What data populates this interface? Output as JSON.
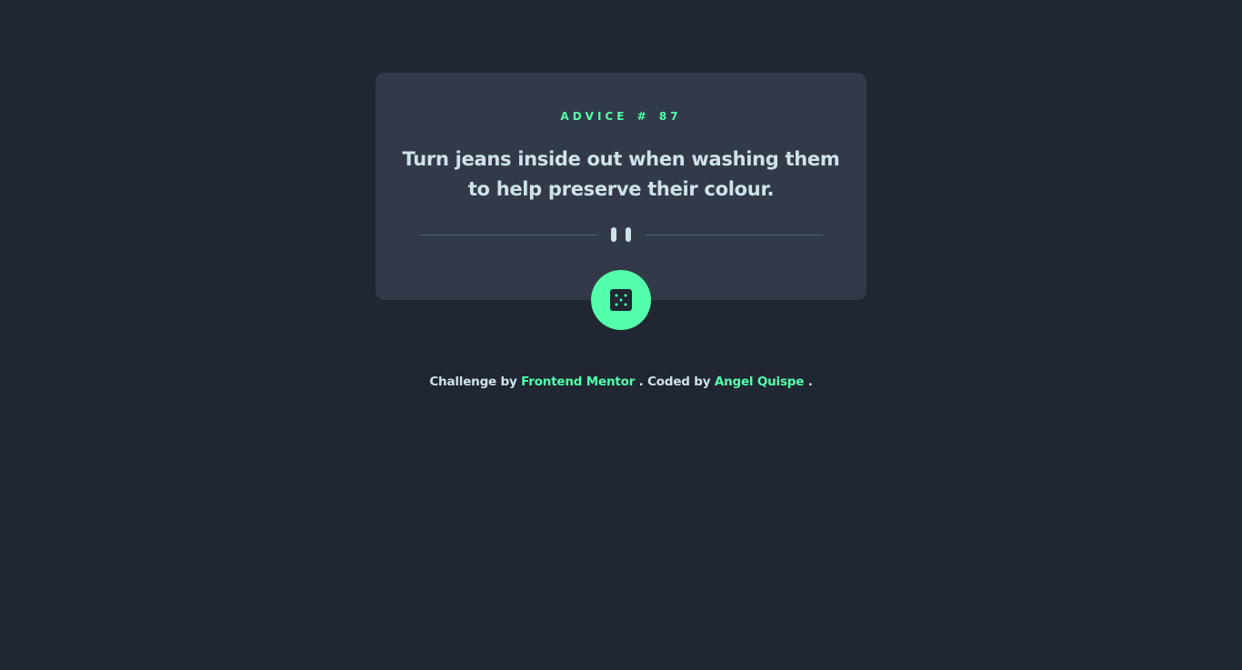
{
  "card": {
    "advice_label": "ADVICE",
    "hash": "#",
    "advice_number": "87",
    "advice_text": "Turn jeans inside out when washing them to help preserve their colour."
  },
  "icons": {
    "divider": "pause-icon",
    "button": "dice-icon"
  },
  "footer": {
    "challenge_by": "Challenge by",
    "frontend_mentor": "Frontend Mentor",
    "coded_by": ". Coded by",
    "author": "Angel Quispe",
    "end": "."
  },
  "colors": {
    "background": "#202632",
    "card": "#323a4a",
    "accent": "#53ffaa",
    "text": "#cee3e9",
    "divider": "#4f5d74"
  }
}
